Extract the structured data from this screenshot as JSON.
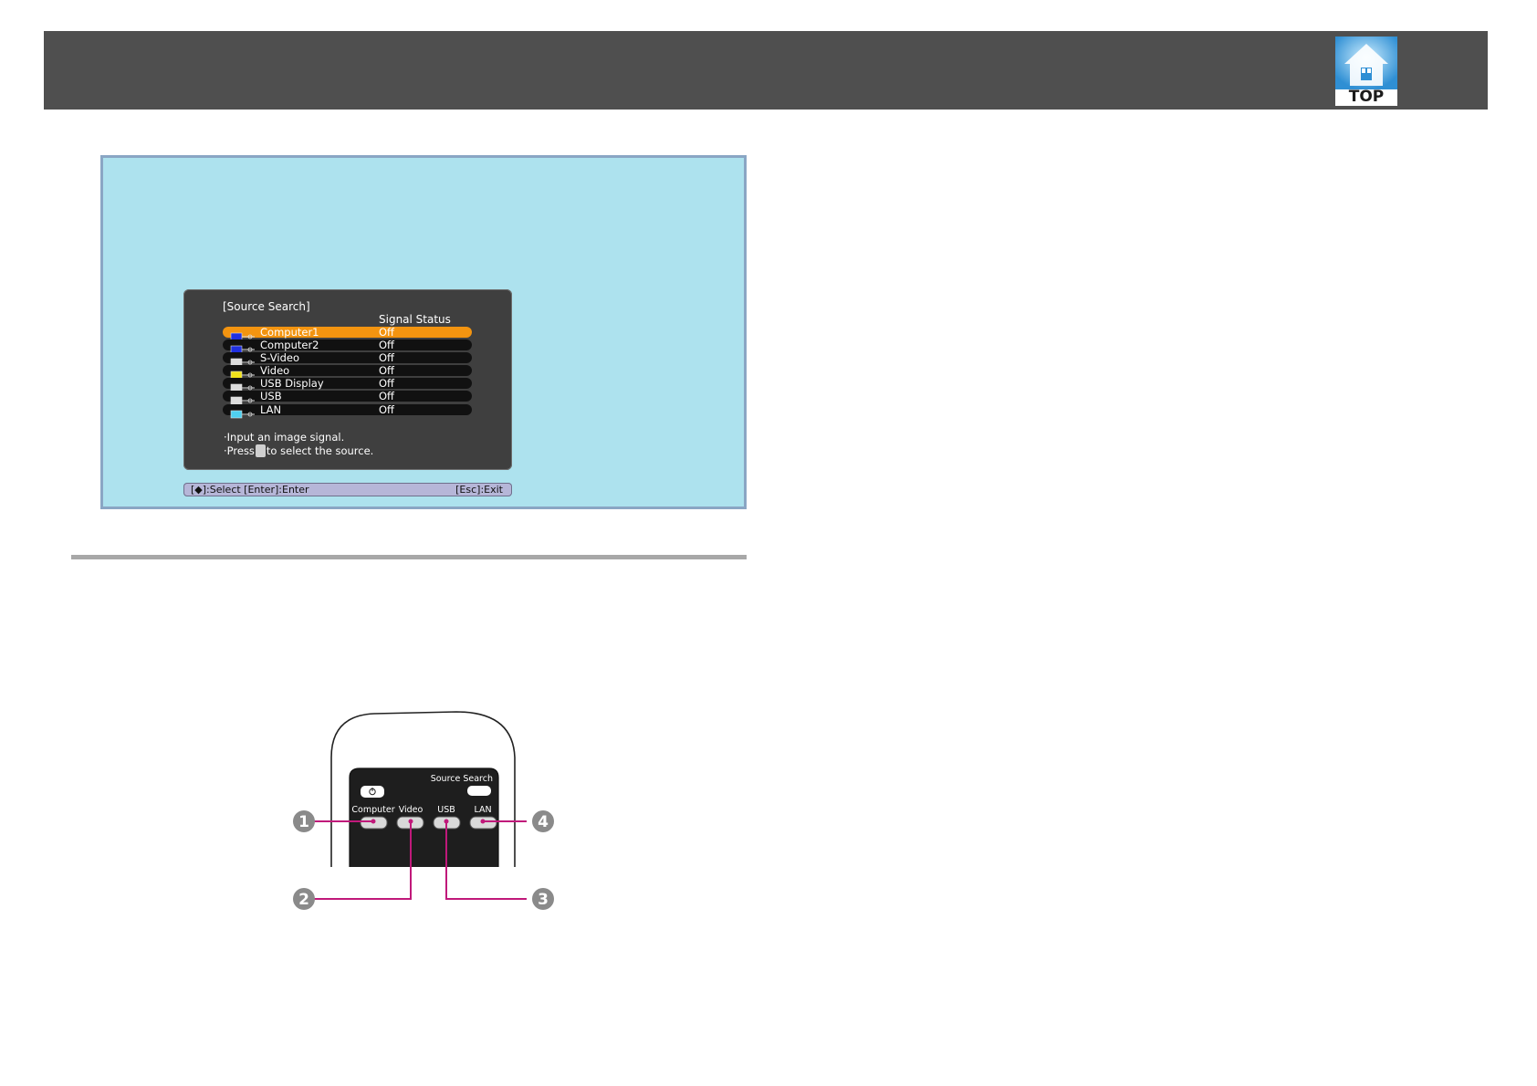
{
  "header": {
    "top_link": "TOP"
  },
  "source_search_menu": {
    "title": "[Source Search]",
    "column_header": "Signal Status",
    "rows": [
      {
        "label": "Computer1",
        "status": "Off",
        "selected": true,
        "icon": "computer-icon"
      },
      {
        "label": "Computer2",
        "status": "Off",
        "selected": false,
        "icon": "computer-icon"
      },
      {
        "label": "S-Video",
        "status": "Off",
        "selected": false,
        "icon": "s-video-icon"
      },
      {
        "label": "Video",
        "status": "Off",
        "selected": false,
        "icon": "video-icon"
      },
      {
        "label": "USB Display",
        "status": "Off",
        "selected": false,
        "icon": "usb-display-icon"
      },
      {
        "label": "USB",
        "status": "Off",
        "selected": false,
        "icon": "usb-icon"
      },
      {
        "label": "LAN",
        "status": "Off",
        "selected": false,
        "icon": "lan-icon"
      }
    ],
    "help_line1": "·Input an image signal.",
    "help_line2_before": "·Press",
    "help_line2_after": "to select the source.",
    "footer_left": "[◆]:Select  [Enter]:Enter",
    "footer_right": "[Esc]:Exit"
  },
  "remote_control": {
    "source_search_label": "Source Search",
    "buttons": [
      "Computer",
      "Video",
      "USB",
      "LAN"
    ],
    "callouts": [
      "1",
      "2",
      "3",
      "4"
    ]
  },
  "colors": {
    "header_bg": "#4f4f4f",
    "screen_bg": "#ade2ee",
    "menu_bg": "#3f3f3f",
    "selected_row": "#f39410",
    "callout_line": "#c0197a"
  }
}
